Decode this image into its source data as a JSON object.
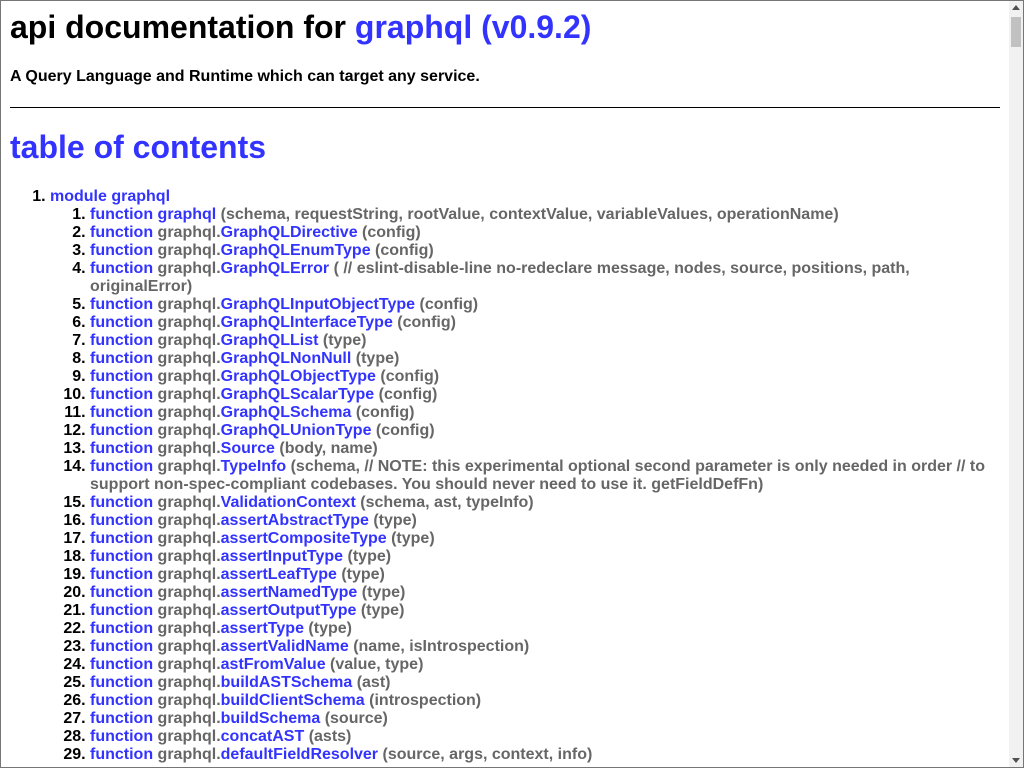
{
  "header": {
    "title_prefix": "api documentation for",
    "title_link": "graphql (v0.9.2)",
    "description": "A Query Language and Runtime which can target any service."
  },
  "toc": {
    "heading": "table of contents",
    "module": {
      "keyword": "module",
      "name": "graphql"
    },
    "items": [
      {
        "kw": "function",
        "prefix": "",
        "name": "graphql",
        "args": "(schema, requestString, rootValue, contextValue, variableValues, operationName)"
      },
      {
        "kw": "function",
        "prefix": "graphql.",
        "name": "GraphQLDirective",
        "args": "(config)"
      },
      {
        "kw": "function",
        "prefix": "graphql.",
        "name": "GraphQLEnumType",
        "args": "(config)"
      },
      {
        "kw": "function",
        "prefix": "graphql.",
        "name": "GraphQLError",
        "args": "( // eslint-disable-line no-redeclare message, nodes, source, positions, path, originalError)"
      },
      {
        "kw": "function",
        "prefix": "graphql.",
        "name": "GraphQLInputObjectType",
        "args": "(config)"
      },
      {
        "kw": "function",
        "prefix": "graphql.",
        "name": "GraphQLInterfaceType",
        "args": "(config)"
      },
      {
        "kw": "function",
        "prefix": "graphql.",
        "name": "GraphQLList",
        "args": "(type)"
      },
      {
        "kw": "function",
        "prefix": "graphql.",
        "name": "GraphQLNonNull",
        "args": "(type)"
      },
      {
        "kw": "function",
        "prefix": "graphql.",
        "name": "GraphQLObjectType",
        "args": "(config)"
      },
      {
        "kw": "function",
        "prefix": "graphql.",
        "name": "GraphQLScalarType",
        "args": "(config)"
      },
      {
        "kw": "function",
        "prefix": "graphql.",
        "name": "GraphQLSchema",
        "args": "(config)"
      },
      {
        "kw": "function",
        "prefix": "graphql.",
        "name": "GraphQLUnionType",
        "args": "(config)"
      },
      {
        "kw": "function",
        "prefix": "graphql.",
        "name": "Source",
        "args": "(body, name)"
      },
      {
        "kw": "function",
        "prefix": "graphql.",
        "name": "TypeInfo",
        "args": "(schema, // NOTE: this experimental optional second parameter is only needed in order // to support non-spec-compliant codebases. You should never need to use it. getFieldDefFn)"
      },
      {
        "kw": "function",
        "prefix": "graphql.",
        "name": "ValidationContext",
        "args": "(schema, ast, typeInfo)"
      },
      {
        "kw": "function",
        "prefix": "graphql.",
        "name": "assertAbstractType",
        "args": "(type)"
      },
      {
        "kw": "function",
        "prefix": "graphql.",
        "name": "assertCompositeType",
        "args": "(type)"
      },
      {
        "kw": "function",
        "prefix": "graphql.",
        "name": "assertInputType",
        "args": "(type)"
      },
      {
        "kw": "function",
        "prefix": "graphql.",
        "name": "assertLeafType",
        "args": "(type)"
      },
      {
        "kw": "function",
        "prefix": "graphql.",
        "name": "assertNamedType",
        "args": "(type)"
      },
      {
        "kw": "function",
        "prefix": "graphql.",
        "name": "assertOutputType",
        "args": "(type)"
      },
      {
        "kw": "function",
        "prefix": "graphql.",
        "name": "assertType",
        "args": "(type)"
      },
      {
        "kw": "function",
        "prefix": "graphql.",
        "name": "assertValidName",
        "args": "(name, isIntrospection)"
      },
      {
        "kw": "function",
        "prefix": "graphql.",
        "name": "astFromValue",
        "args": "(value, type)"
      },
      {
        "kw": "function",
        "prefix": "graphql.",
        "name": "buildASTSchema",
        "args": "(ast)"
      },
      {
        "kw": "function",
        "prefix": "graphql.",
        "name": "buildClientSchema",
        "args": "(introspection)"
      },
      {
        "kw": "function",
        "prefix": "graphql.",
        "name": "buildSchema",
        "args": "(source)"
      },
      {
        "kw": "function",
        "prefix": "graphql.",
        "name": "concatAST",
        "args": "(asts)"
      },
      {
        "kw": "function",
        "prefix": "graphql.",
        "name": "defaultFieldResolver",
        "args": "(source, args, context, info)"
      }
    ]
  }
}
